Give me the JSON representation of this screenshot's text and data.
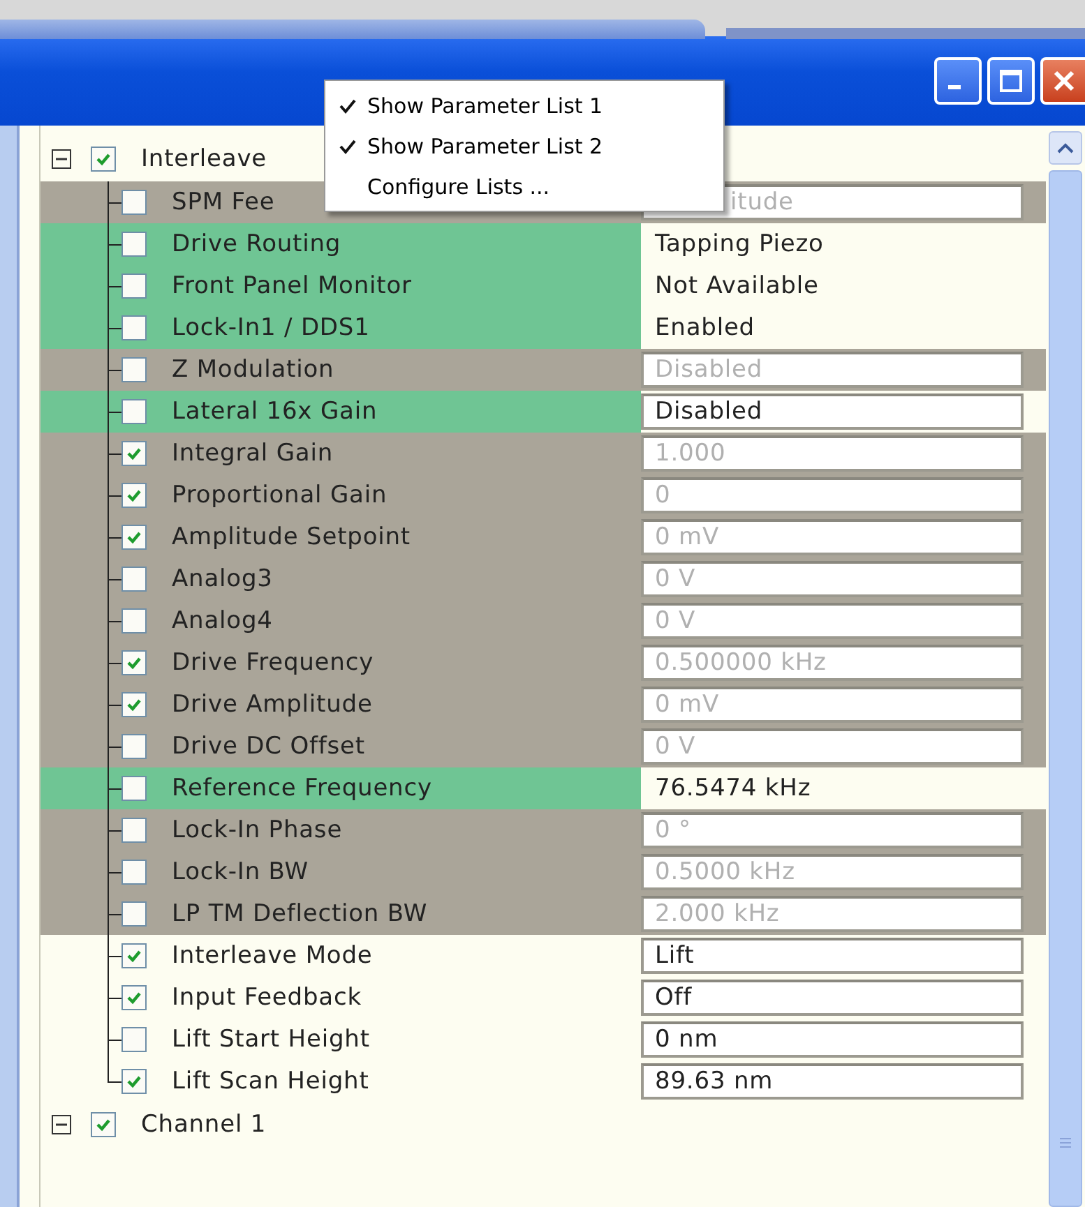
{
  "menu": {
    "items": [
      {
        "label": "Show Parameter List 1",
        "checked": true
      },
      {
        "label": "Show Parameter List 2",
        "checked": true
      },
      {
        "label": "Configure Lists ...",
        "checked": false
      }
    ]
  },
  "tree": [
    {
      "label": "Interleave",
      "checked": true,
      "expanded": true,
      "children": [
        {
          "label": "SPM Fee",
          "checked": false,
          "shaded": true,
          "highlighted": false,
          "value": "itude",
          "boxed": true,
          "disabled": true,
          "covered": true
        },
        {
          "label": "Drive Routing",
          "checked": false,
          "shaded": false,
          "highlighted": true,
          "value": "Tapping Piezo",
          "boxed": false,
          "disabled": false,
          "covered": false
        },
        {
          "label": "Front Panel Monitor",
          "checked": false,
          "shaded": false,
          "highlighted": true,
          "value": "Not Available",
          "boxed": false,
          "disabled": false,
          "covered": false
        },
        {
          "label": "Lock-In1 / DDS1",
          "checked": false,
          "shaded": false,
          "highlighted": true,
          "value": "Enabled",
          "boxed": false,
          "disabled": false,
          "covered": false
        },
        {
          "label": "Z Modulation",
          "checked": false,
          "shaded": true,
          "highlighted": false,
          "value": "Disabled",
          "boxed": true,
          "disabled": true,
          "covered": false
        },
        {
          "label": "Lateral 16x Gain",
          "checked": false,
          "shaded": false,
          "highlighted": true,
          "value": "Disabled",
          "boxed": true,
          "disabled": false,
          "covered": false
        },
        {
          "label": "Integral Gain",
          "checked": true,
          "shaded": true,
          "highlighted": false,
          "value": "1.000",
          "boxed": true,
          "disabled": true,
          "covered": false
        },
        {
          "label": "Proportional Gain",
          "checked": true,
          "shaded": true,
          "highlighted": false,
          "value": "0",
          "boxed": true,
          "disabled": true,
          "covered": false
        },
        {
          "label": "Amplitude Setpoint",
          "checked": true,
          "shaded": true,
          "highlighted": false,
          "value": "0 mV",
          "boxed": true,
          "disabled": true,
          "covered": false
        },
        {
          "label": "Analog3",
          "checked": false,
          "shaded": true,
          "highlighted": false,
          "value": "0 V",
          "boxed": true,
          "disabled": true,
          "covered": false
        },
        {
          "label": "Analog4",
          "checked": false,
          "shaded": true,
          "highlighted": false,
          "value": "0 V",
          "boxed": true,
          "disabled": true,
          "covered": false
        },
        {
          "label": "Drive Frequency",
          "checked": true,
          "shaded": true,
          "highlighted": false,
          "value": "0.500000 kHz",
          "boxed": true,
          "disabled": true,
          "covered": false
        },
        {
          "label": "Drive Amplitude",
          "checked": true,
          "shaded": true,
          "highlighted": false,
          "value": "0 mV",
          "boxed": true,
          "disabled": true,
          "covered": false
        },
        {
          "label": "Drive DC Offset",
          "checked": false,
          "shaded": true,
          "highlighted": false,
          "value": "0 V",
          "boxed": true,
          "disabled": true,
          "covered": false
        },
        {
          "label": "Reference Frequency",
          "checked": false,
          "shaded": false,
          "highlighted": true,
          "value": "76.5474 kHz",
          "boxed": false,
          "disabled": false,
          "covered": false
        },
        {
          "label": "Lock-In Phase",
          "checked": false,
          "shaded": true,
          "highlighted": false,
          "value": "0 °",
          "boxed": true,
          "disabled": true,
          "covered": false
        },
        {
          "label": "Lock-In BW",
          "checked": false,
          "shaded": true,
          "highlighted": false,
          "value": "0.5000 kHz",
          "boxed": true,
          "disabled": true,
          "covered": false
        },
        {
          "label": "LP TM Deflection BW",
          "checked": false,
          "shaded": true,
          "highlighted": false,
          "value": "2.000 kHz",
          "boxed": true,
          "disabled": true,
          "covered": false
        },
        {
          "label": "Interleave Mode",
          "checked": true,
          "shaded": false,
          "highlighted": false,
          "value": "Lift",
          "boxed": true,
          "disabled": false,
          "covered": false
        },
        {
          "label": "Input Feedback",
          "checked": true,
          "shaded": false,
          "highlighted": false,
          "value": "Off",
          "boxed": true,
          "disabled": false,
          "covered": false
        },
        {
          "label": "Lift Start Height",
          "checked": false,
          "shaded": false,
          "highlighted": false,
          "value": "0 nm",
          "boxed": true,
          "disabled": false,
          "covered": false
        },
        {
          "label": "Lift Scan Height",
          "checked": true,
          "shaded": false,
          "highlighted": false,
          "value": "89.63 nm",
          "boxed": true,
          "disabled": false,
          "covered": false
        }
      ]
    },
    {
      "label": "Channel 1",
      "checked": true,
      "expanded": true
    }
  ]
}
